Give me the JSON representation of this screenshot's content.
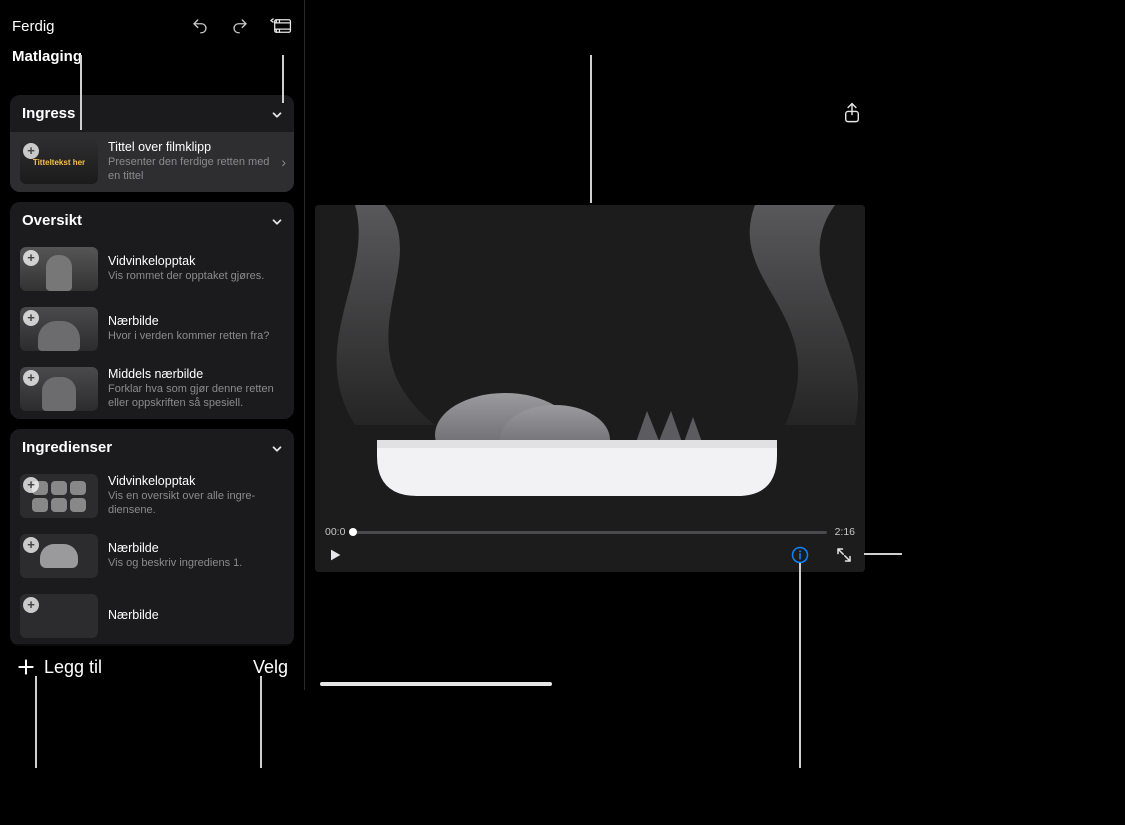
{
  "toolbar": {
    "done": "Ferdig",
    "project_name": "Matlaging"
  },
  "sidebar_bottom": {
    "add": "Legg til",
    "select": "Velg"
  },
  "sections": [
    {
      "title": "Ingress",
      "items": [
        {
          "title": "Tittel over filmklipp",
          "desc": "Presenter den ferdige retten med en tittel",
          "thumb_label": "Titteltekst her",
          "selected": true,
          "disclosure": true
        }
      ]
    },
    {
      "title": "Oversikt",
      "items": [
        {
          "title": "Vidvinkelopptak",
          "desc": "Vis rommet der opptaket gjøres."
        },
        {
          "title": "Nærbilde",
          "desc": "Hvor i verden kommer retten fra?"
        },
        {
          "title": "Middels nærbilde",
          "desc": "Forklar hva som gjør denne retten eller oppskriften så spesiell."
        }
      ]
    },
    {
      "title": "Ingredienser",
      "items": [
        {
          "title": "Vidvinkelopptak",
          "desc": "Vis en oversikt over alle ingre-diensene."
        },
        {
          "title": "Nærbilde",
          "desc": "Vis og beskriv ingrediens 1."
        },
        {
          "title": "Nærbilde",
          "desc": ""
        }
      ]
    }
  ],
  "preview": {
    "time_left": "00:0",
    "time_right": "2:16"
  },
  "colors": {
    "accent": "#0a84ff",
    "info": "#0a84ff"
  }
}
